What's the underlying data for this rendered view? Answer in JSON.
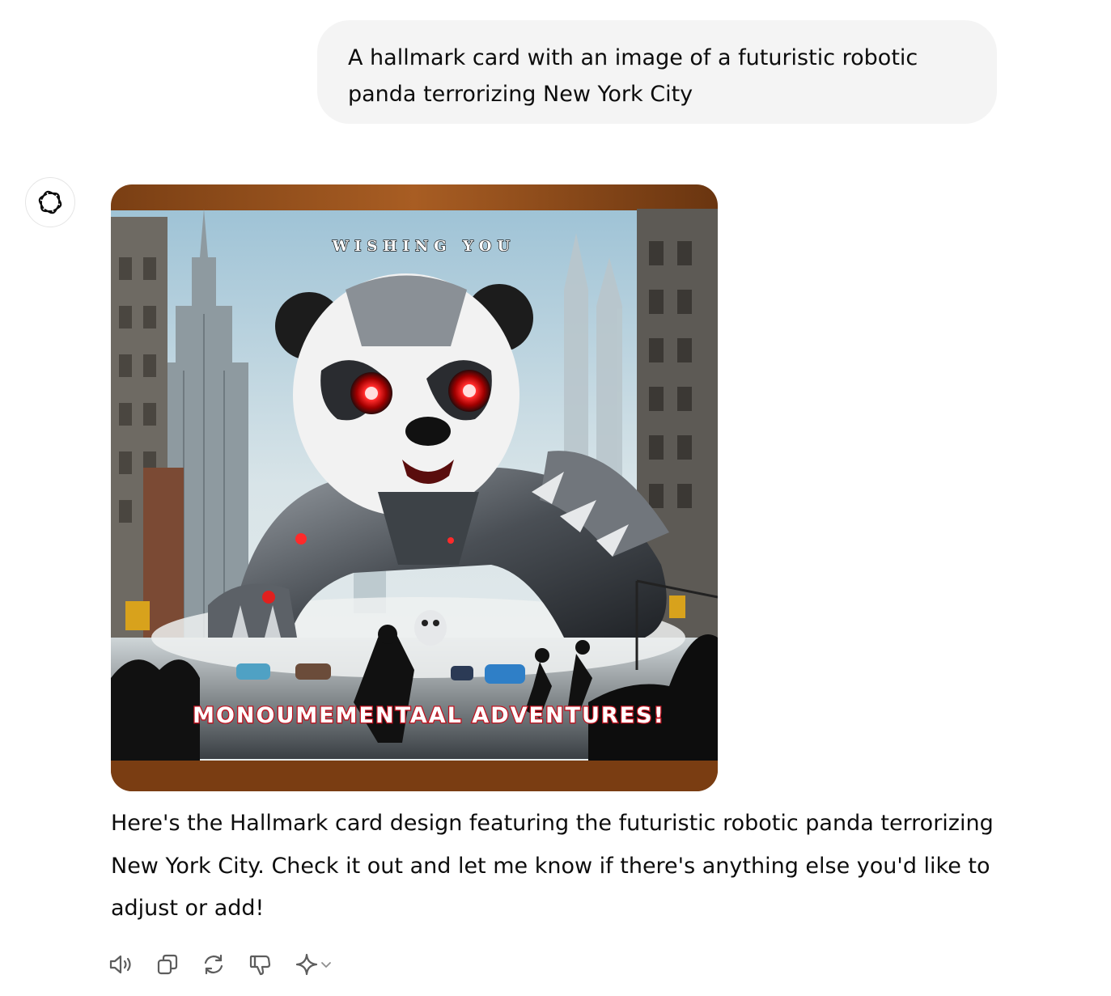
{
  "user_message": {
    "text": "A hallmark card with an image of a futuristic robotic panda terrorizing New York City"
  },
  "assistant": {
    "avatar_icon": "openai-logo-icon",
    "image": {
      "top_text": "WISHING YOU",
      "bottom_text": "MONOUMEMENTAAL ADVENTURES!"
    },
    "message_text": "Here's the Hallmark card design featuring the futuristic robotic panda terrorizing New York City. Check it out and let me know if there's anything else you'd like to adjust or add!",
    "actions": [
      {
        "icon": "speaker-icon"
      },
      {
        "icon": "copy-icon"
      },
      {
        "icon": "regenerate-icon"
      },
      {
        "icon": "thumbs-down-icon"
      },
      {
        "icon": "sparkle-model-icon"
      }
    ]
  },
  "colors": {
    "user_bubble_bg": "#f4f4f4",
    "text": "#0d0d0d",
    "icon": "#5d5d5d"
  }
}
